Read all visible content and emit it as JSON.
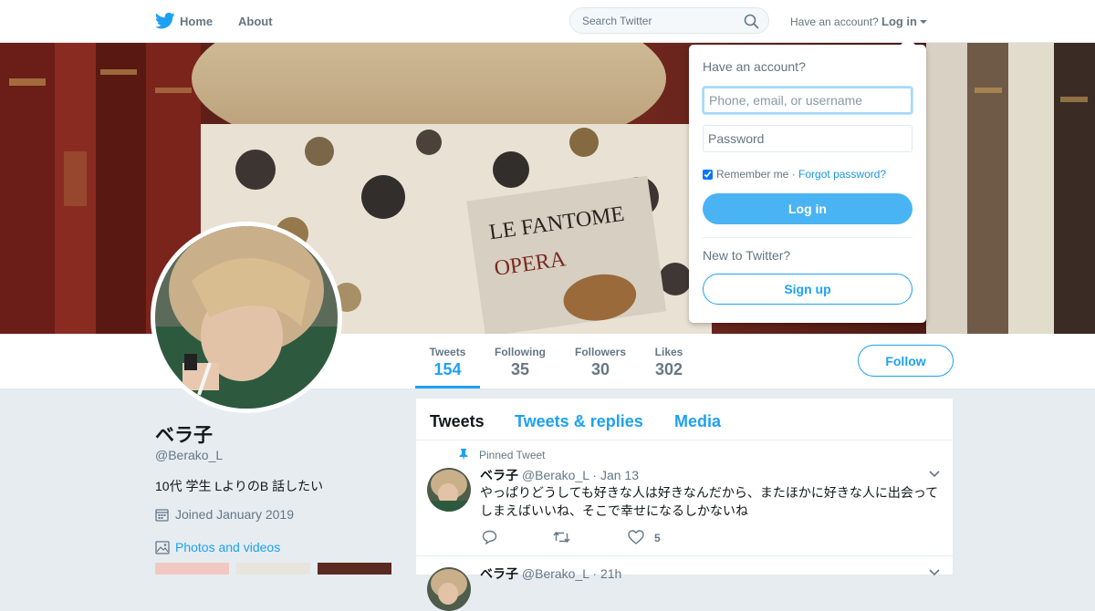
{
  "nav": {
    "home_label": "Home",
    "about_label": "About",
    "search_placeholder": "Search Twitter",
    "have_account": "Have an account?",
    "login_label": "Log in"
  },
  "profile": {
    "name": "ベラ子",
    "handle": "@Berako_L",
    "bio": "10代 学生 LよりのB 話したい",
    "joined": "Joined January 2019",
    "photos_label": "Photos and videos"
  },
  "stats": [
    {
      "label": "Tweets",
      "value": "154"
    },
    {
      "label": "Following",
      "value": "35"
    },
    {
      "label": "Followers",
      "value": "30"
    },
    {
      "label": "Likes",
      "value": "302"
    }
  ],
  "follow_label": "Follow",
  "timeline": {
    "tabs": [
      "Tweets",
      "Tweets & replies",
      "Media"
    ],
    "tweets": [
      {
        "pinned_label": "Pinned Tweet",
        "name": "ベラ子",
        "handle": "@Berako_L",
        "dot": "·",
        "date": "Jan 13",
        "text": "やっぱりどうしても好きな人は好きなんだから、またほかに好きな人に出会ってしまえばいいね、そこで幸せになるしかないね",
        "likes": "5"
      },
      {
        "name": "ベラ子",
        "handle": "@Berako_L",
        "dot": "·",
        "date": "21h"
      }
    ]
  },
  "login_dropdown": {
    "title": "Have an account?",
    "username_placeholder": "Phone, email, or username",
    "password_placeholder": "Password",
    "remember_label": "Remember me",
    "separator": "·",
    "forgot_label": "Forgot password?",
    "login_button": "Log in",
    "new_label": "New to Twitter?",
    "signup_button": "Sign up"
  },
  "colors": {
    "accent": "#1da1f2",
    "login_button_bg": "#4ab3f4",
    "page_bg": "#e6ecf0"
  }
}
